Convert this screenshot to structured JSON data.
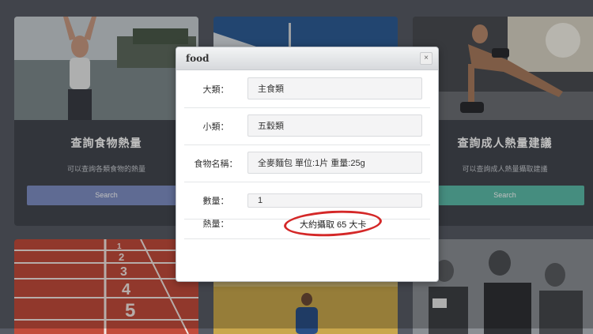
{
  "cards": [
    {
      "title": "查詢食物熱量",
      "desc": "可以查詢各類食物的熱量",
      "button": "Search",
      "button_color": "#7f8fc4"
    },
    {
      "title": "查詢成人熱量建議",
      "desc": "可以查詢成人熱量攝取建議",
      "button": "Search",
      "button_color": "#5dbdaa"
    }
  ],
  "track_numbers": [
    "1",
    "2",
    "3",
    "4",
    "5"
  ],
  "modal": {
    "title": "food",
    "close_icon": "close-icon",
    "rows": [
      {
        "label": "大類：",
        "value": "主食類"
      },
      {
        "label": "小類：",
        "value": "五穀類"
      },
      {
        "label": "食物名稱：",
        "value": "全麥麵包 單位:1片 重量:25g"
      },
      {
        "label": "數量：",
        "value": "1"
      },
      {
        "label": "熱量：",
        "value": "大約攝取 65 大卡"
      }
    ]
  },
  "colors": {
    "background": "#575b65",
    "card": "#43474f",
    "highlight": "#d42828"
  }
}
